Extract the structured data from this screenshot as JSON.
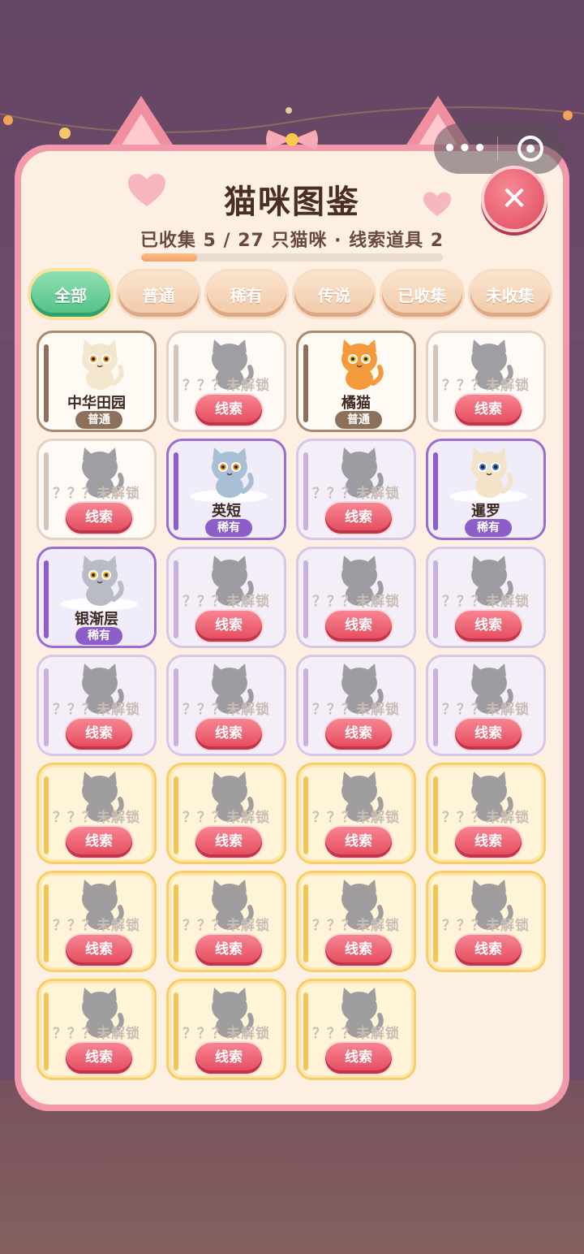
{
  "capsule": {
    "more_label": "•••"
  },
  "header": {
    "title": "猫咪图鉴",
    "subtitle": "已收集 5 / 27 只猫咪 · 线索道具 2",
    "progress": 0.185,
    "close_label": "✕"
  },
  "tabs": [
    {
      "label": "全部",
      "active": true
    },
    {
      "label": "普通",
      "active": false
    },
    {
      "label": "稀有",
      "active": false
    },
    {
      "label": "传说",
      "active": false
    },
    {
      "label": "已收集",
      "active": false
    },
    {
      "label": "未收集",
      "active": false
    }
  ],
  "cards": [
    {
      "rarity": "common",
      "owned": true,
      "name": "中华田园",
      "badge": "普通",
      "color": "#f3e6cf",
      "eye": "#e6a02a"
    },
    {
      "rarity": "common",
      "owned": false,
      "unknown": "？？？未解锁",
      "clue": "线索"
    },
    {
      "rarity": "common",
      "owned": true,
      "name": "橘猫",
      "badge": "普通",
      "color": "#f39a3c",
      "eye": "#f2c12a"
    },
    {
      "rarity": "common",
      "owned": false,
      "unknown": "？？？未解锁",
      "clue": "线索"
    },
    {
      "rarity": "common",
      "owned": false,
      "unknown": "？？？未解锁",
      "clue": "线索"
    },
    {
      "rarity": "rare",
      "owned": true,
      "name": "英短",
      "badge": "稀有",
      "color": "#a8bfd6",
      "eye": "#e89a1e"
    },
    {
      "rarity": "rare",
      "owned": false,
      "unknown": "？？？未解锁",
      "clue": "线索"
    },
    {
      "rarity": "rare",
      "owned": true,
      "name": "暹罗",
      "badge": "稀有",
      "color": "#f3e3c8",
      "eye": "#3a78d0"
    },
    {
      "rarity": "rare",
      "owned": true,
      "name": "银渐层",
      "badge": "稀有",
      "color": "#b9bcc4",
      "eye": "#e8b31e"
    },
    {
      "rarity": "rare",
      "owned": false,
      "unknown": "？？？未解锁",
      "clue": "线索"
    },
    {
      "rarity": "rare",
      "owned": false,
      "unknown": "？？？未解锁",
      "clue": "线索"
    },
    {
      "rarity": "rare",
      "owned": false,
      "unknown": "？？？未解锁",
      "clue": "线索"
    },
    {
      "rarity": "rare",
      "owned": false,
      "unknown": "？？？未解锁",
      "clue": "线索"
    },
    {
      "rarity": "rare",
      "owned": false,
      "unknown": "？？？未解锁",
      "clue": "线索"
    },
    {
      "rarity": "rare",
      "owned": false,
      "unknown": "？？？未解锁",
      "clue": "线索"
    },
    {
      "rarity": "rare",
      "owned": false,
      "unknown": "？？？未解锁",
      "clue": "线索"
    },
    {
      "rarity": "legend",
      "owned": false,
      "unknown": "？？？未解锁",
      "clue": "线索"
    },
    {
      "rarity": "legend",
      "owned": false,
      "unknown": "？？？未解锁",
      "clue": "线索"
    },
    {
      "rarity": "legend",
      "owned": false,
      "unknown": "？？？未解锁",
      "clue": "线索"
    },
    {
      "rarity": "legend",
      "owned": false,
      "unknown": "？？？未解锁",
      "clue": "线索"
    },
    {
      "rarity": "legend",
      "owned": false,
      "unknown": "？？？未解锁",
      "clue": "线索"
    },
    {
      "rarity": "legend",
      "owned": false,
      "unknown": "？？？未解锁",
      "clue": "线索"
    },
    {
      "rarity": "legend",
      "owned": false,
      "unknown": "？？？未解锁",
      "clue": "线索"
    },
    {
      "rarity": "legend",
      "owned": false,
      "unknown": "？？？未解锁",
      "clue": "线索"
    },
    {
      "rarity": "legend",
      "owned": false,
      "unknown": "？？？未解锁",
      "clue": "线索"
    },
    {
      "rarity": "legend",
      "owned": false,
      "unknown": "？？？未解锁",
      "clue": "线索"
    },
    {
      "rarity": "legend",
      "owned": false,
      "unknown": "？？？未解锁",
      "clue": "线索"
    }
  ],
  "colors": {
    "locked_cat": "#8f8d95",
    "accent_pink": "#f29aac",
    "clue_red": "#e4495c"
  }
}
